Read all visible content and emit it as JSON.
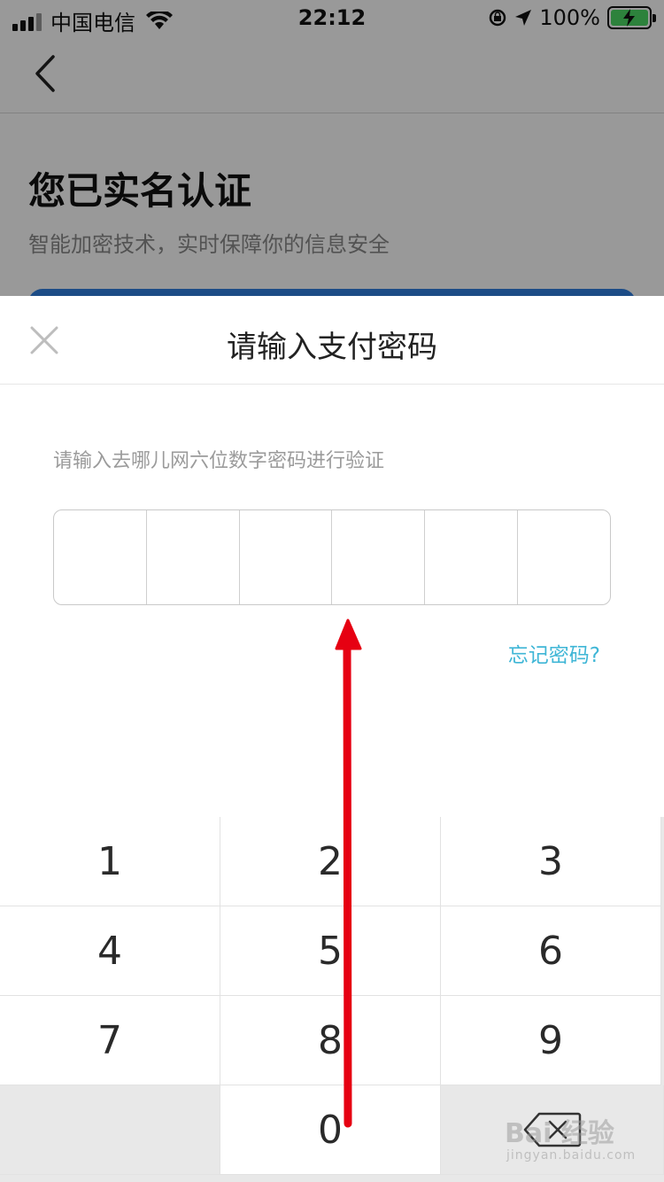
{
  "status_bar": {
    "carrier": "中国电信",
    "time": "22:12",
    "battery_percent": "100%",
    "signal_bars_active": 3,
    "battery_level": 1.0,
    "icons": [
      "signal-icon",
      "wifi-icon",
      "orientation-lock-icon",
      "location-icon",
      "battery-charging-icon"
    ]
  },
  "background_page": {
    "back_icon": "back-chevron-icon",
    "title": "您已实名认证",
    "subtitle": "智能加密技术，实时保障你的信息安全"
  },
  "sheet": {
    "close_icon": "close-icon",
    "title": "请输入支付密码",
    "hint": "请输入去哪儿网六位数字密码进行验证",
    "pin_length": 6,
    "forgot_link": "忘记密码?"
  },
  "keypad": {
    "keys": [
      "1",
      "2",
      "3",
      "4",
      "5",
      "6",
      "7",
      "8",
      "9",
      "",
      "0"
    ],
    "delete_icon": "backspace-icon"
  },
  "watermark": {
    "main": "Bai 经验",
    "sub": "jingyan.baidu.com"
  },
  "colors": {
    "accent_link": "#3fb6d6",
    "annotation_arrow": "#e60012",
    "card_blue": "#2f7fe0"
  }
}
